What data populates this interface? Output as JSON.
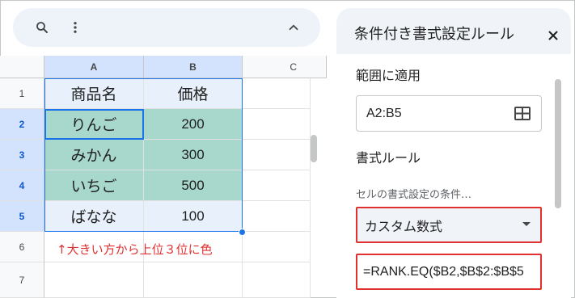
{
  "toolbar": {
    "search_icon": "search-icon",
    "more_icon": "more-vert-icon",
    "collapse_icon": "chevron-up-icon"
  },
  "sheet": {
    "columns": [
      "A",
      "B",
      "C"
    ],
    "rows": [
      "1",
      "2",
      "3",
      "4",
      "5",
      "6",
      "7"
    ],
    "cells": [
      [
        "商品名",
        "価格"
      ],
      [
        "りんご",
        "200"
      ],
      [
        "みかん",
        "300"
      ],
      [
        "いちご",
        "500"
      ],
      [
        "ばなな",
        "100"
      ]
    ],
    "annotation": "↑大きい方から上位３位に色"
  },
  "panel": {
    "title": "条件付き書式設定ルール",
    "close_icon": "close-icon",
    "range_label": "範囲に適用",
    "range_value": "A2:B5",
    "range_icon": "grid-select-icon",
    "rules_label": "書式ルール",
    "condition_label": "セルの書式設定の条件…",
    "condition_value": "カスタム数式",
    "formula_value": "=RANK.EQ($B2,$B$2:$B$5"
  },
  "colors": {
    "highlight_fill": "#a8d8cc",
    "header_fill": "#e8f1fb",
    "selected_header": "#d3e3fd",
    "accent": "#1a73e8",
    "annotation": "#e03131"
  }
}
